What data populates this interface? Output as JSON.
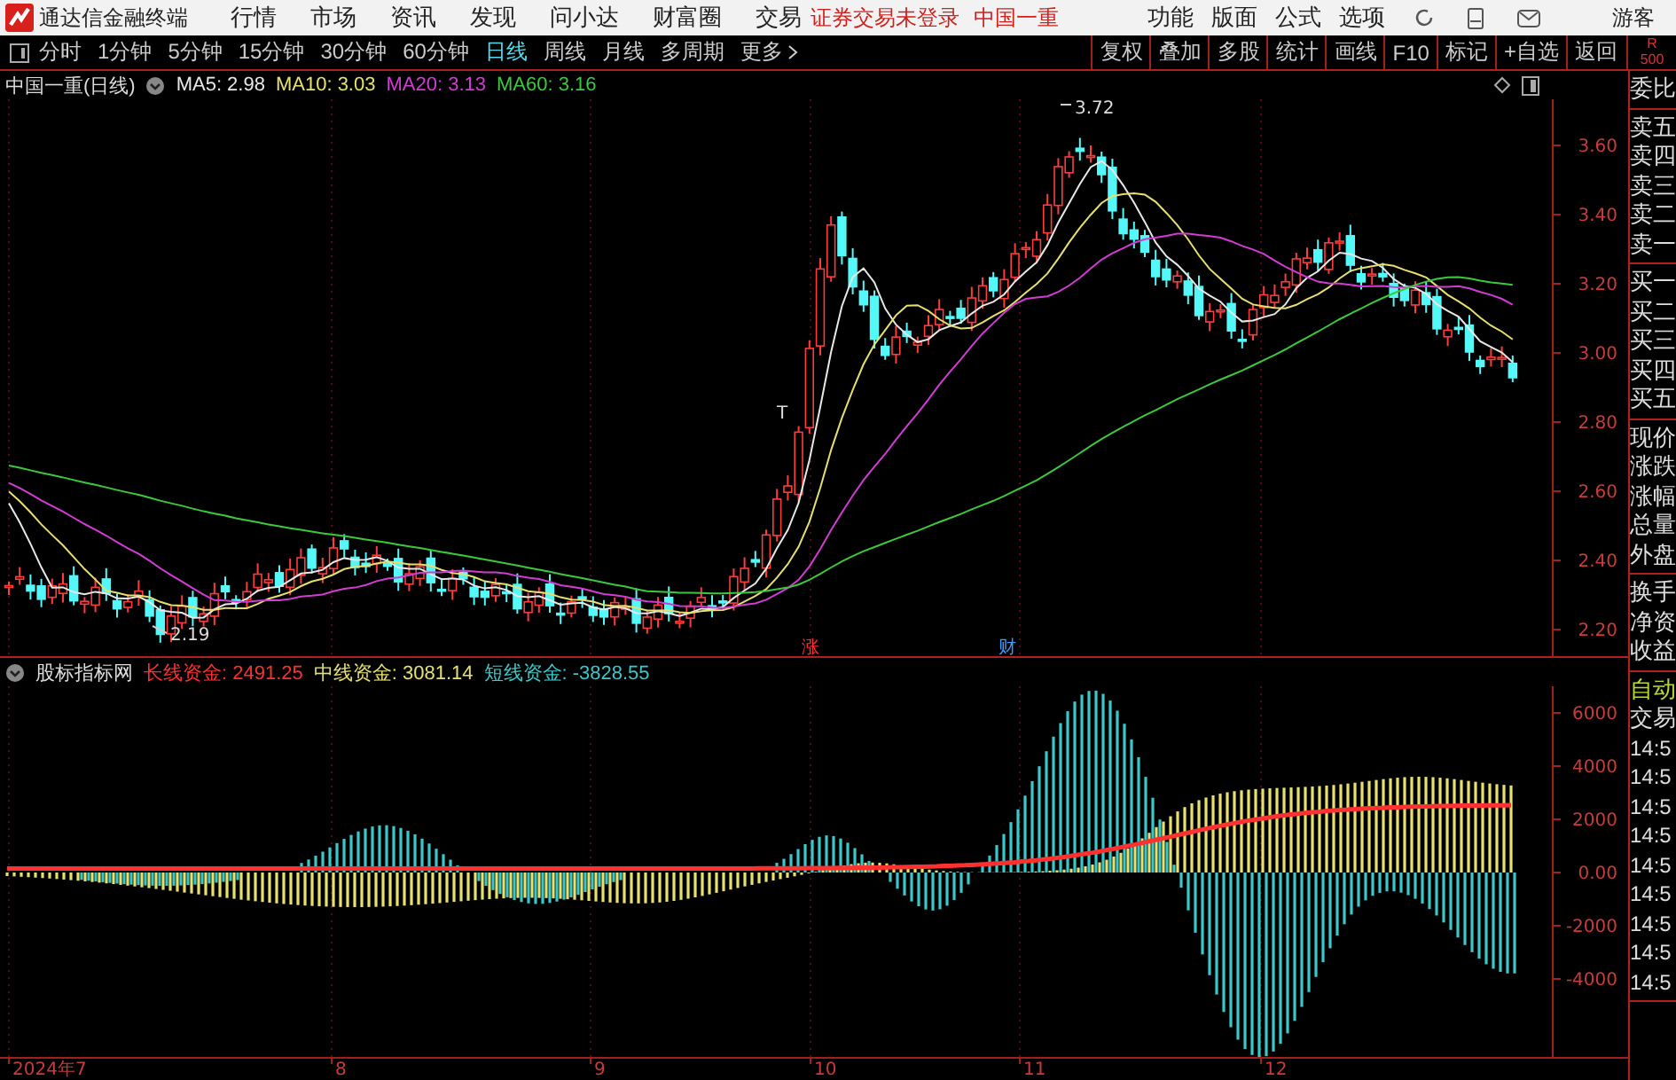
{
  "app_bar": {
    "title": "通达信金融终端",
    "menus": [
      "行情",
      "市场",
      "资讯",
      "发现",
      "问小达",
      "财富圈",
      "交易"
    ],
    "status": [
      "证券交易未登录",
      "中国一重"
    ],
    "tools": [
      "功能",
      "版面",
      "公式",
      "选项"
    ],
    "user": "游客"
  },
  "toolbar": {
    "periods": [
      {
        "label": "分时",
        "selected": false
      },
      {
        "label": "1分钟",
        "selected": false
      },
      {
        "label": "5分钟",
        "selected": false
      },
      {
        "label": "15分钟",
        "selected": false
      },
      {
        "label": "30分钟",
        "selected": false
      },
      {
        "label": "60分钟",
        "selected": false
      },
      {
        "label": "日线",
        "selected": true
      },
      {
        "label": "周线",
        "selected": false
      },
      {
        "label": "月线",
        "selected": false
      },
      {
        "label": "多周期",
        "selected": false
      }
    ],
    "more": "更多",
    "actions": [
      "复权",
      "叠加",
      "多股",
      "统计",
      "画线",
      "F10",
      "标记",
      "+自选",
      "返回"
    ],
    "corner": [
      "R",
      "500"
    ]
  },
  "price_chart": {
    "title": "中国一重(日线)",
    "ma_legend": [
      {
        "label": "MA5: 2.98",
        "color": "#e8e8e8"
      },
      {
        "label": "MA10: 3.03",
        "color": "#e6e070"
      },
      {
        "label": "MA20: 3.13",
        "color": "#d23cd2"
      },
      {
        "label": "MA60: 3.16",
        "color": "#3cc83c"
      }
    ],
    "axis_labels": [
      "3.60",
      "3.40",
      "3.20",
      "3.00",
      "2.80",
      "2.60",
      "2.40",
      "2.20"
    ],
    "annotations": [
      {
        "text": "3.72"
      },
      {
        "text": "2.19"
      },
      {
        "text": "T"
      },
      {
        "text": "涨",
        "color": "#ff3030"
      },
      {
        "text": "财",
        "color": "#3c9cff"
      }
    ]
  },
  "indicator": {
    "title": "股标指标网",
    "series": [
      {
        "name": "长线资金:",
        "value": "2491.25",
        "color": "#ff3030"
      },
      {
        "name": "中线资金:",
        "value": "3081.14",
        "color": "#e6e070"
      },
      {
        "name": "短线资金:",
        "value": "-3828.55",
        "color": "#3cc8c8"
      }
    ],
    "axis_labels": [
      "6000",
      "4000",
      "2000",
      "0.00",
      "-2000",
      "-4000"
    ]
  },
  "x_axis": [
    "2024年7",
    "8",
    "9",
    "10",
    "11",
    "12"
  ],
  "quote_panel": {
    "groups": [
      [
        "委比"
      ],
      [
        "卖五",
        "卖四",
        "卖三",
        "卖二",
        "卖一"
      ],
      [
        "买一",
        "买二",
        "买三",
        "买四",
        "买五"
      ],
      [
        "现价",
        "涨跌",
        "涨幅",
        "总量",
        "外盘"
      ],
      [
        "换手",
        "净资",
        "收益"
      ]
    ],
    "auto": "自动",
    "trade": "交易",
    "times": [
      "14:5",
      "14:5",
      "14:5",
      "14:5",
      "14:5",
      "14:5",
      "14:5",
      "14:5",
      "14:5"
    ]
  }
}
